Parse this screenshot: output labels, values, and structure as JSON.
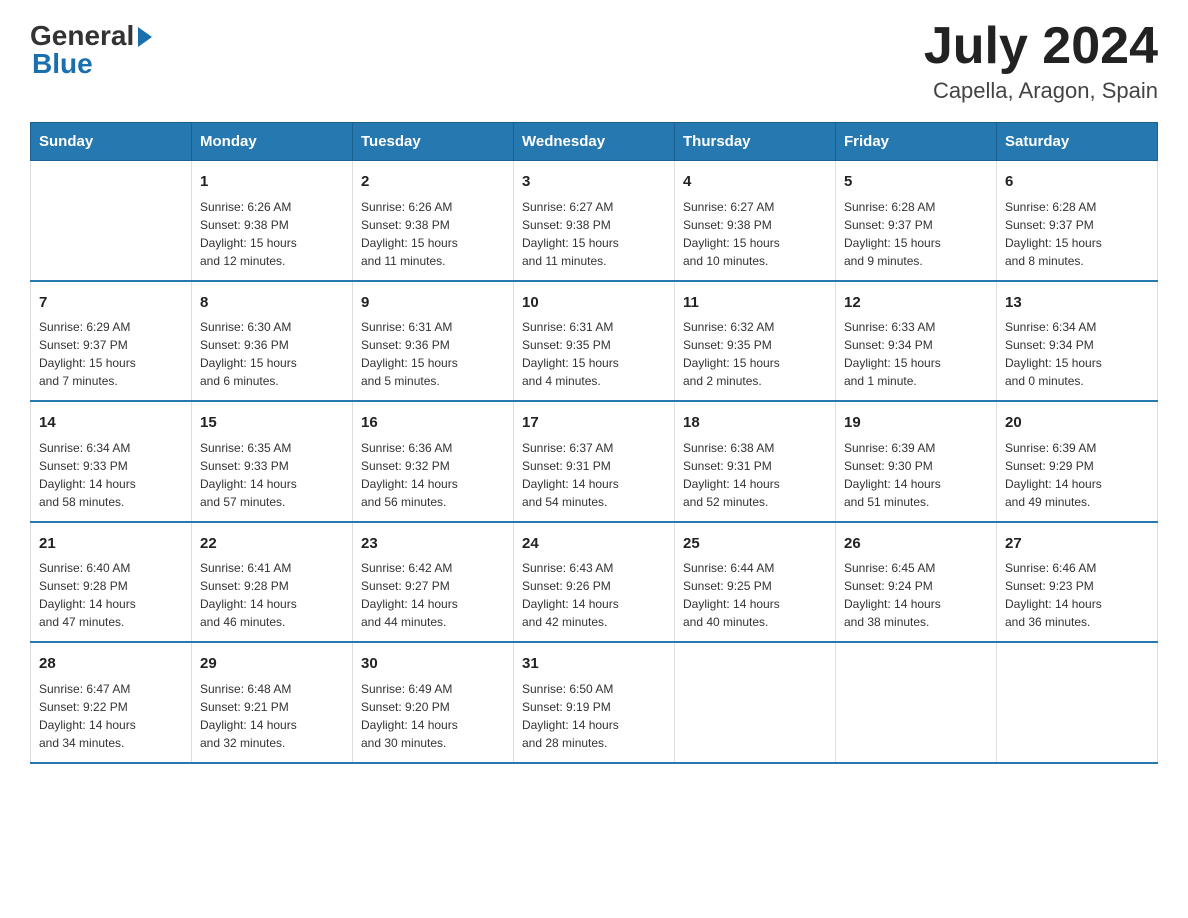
{
  "logo": {
    "general": "General",
    "blue": "Blue"
  },
  "title": "July 2024",
  "subtitle": "Capella, Aragon, Spain",
  "days_of_week": [
    "Sunday",
    "Monday",
    "Tuesday",
    "Wednesday",
    "Thursday",
    "Friday",
    "Saturday"
  ],
  "weeks": [
    [
      {
        "day": "",
        "info": ""
      },
      {
        "day": "1",
        "info": "Sunrise: 6:26 AM\nSunset: 9:38 PM\nDaylight: 15 hours\nand 12 minutes."
      },
      {
        "day": "2",
        "info": "Sunrise: 6:26 AM\nSunset: 9:38 PM\nDaylight: 15 hours\nand 11 minutes."
      },
      {
        "day": "3",
        "info": "Sunrise: 6:27 AM\nSunset: 9:38 PM\nDaylight: 15 hours\nand 11 minutes."
      },
      {
        "day": "4",
        "info": "Sunrise: 6:27 AM\nSunset: 9:38 PM\nDaylight: 15 hours\nand 10 minutes."
      },
      {
        "day": "5",
        "info": "Sunrise: 6:28 AM\nSunset: 9:37 PM\nDaylight: 15 hours\nand 9 minutes."
      },
      {
        "day": "6",
        "info": "Sunrise: 6:28 AM\nSunset: 9:37 PM\nDaylight: 15 hours\nand 8 minutes."
      }
    ],
    [
      {
        "day": "7",
        "info": "Sunrise: 6:29 AM\nSunset: 9:37 PM\nDaylight: 15 hours\nand 7 minutes."
      },
      {
        "day": "8",
        "info": "Sunrise: 6:30 AM\nSunset: 9:36 PM\nDaylight: 15 hours\nand 6 minutes."
      },
      {
        "day": "9",
        "info": "Sunrise: 6:31 AM\nSunset: 9:36 PM\nDaylight: 15 hours\nand 5 minutes."
      },
      {
        "day": "10",
        "info": "Sunrise: 6:31 AM\nSunset: 9:35 PM\nDaylight: 15 hours\nand 4 minutes."
      },
      {
        "day": "11",
        "info": "Sunrise: 6:32 AM\nSunset: 9:35 PM\nDaylight: 15 hours\nand 2 minutes."
      },
      {
        "day": "12",
        "info": "Sunrise: 6:33 AM\nSunset: 9:34 PM\nDaylight: 15 hours\nand 1 minute."
      },
      {
        "day": "13",
        "info": "Sunrise: 6:34 AM\nSunset: 9:34 PM\nDaylight: 15 hours\nand 0 minutes."
      }
    ],
    [
      {
        "day": "14",
        "info": "Sunrise: 6:34 AM\nSunset: 9:33 PM\nDaylight: 14 hours\nand 58 minutes."
      },
      {
        "day": "15",
        "info": "Sunrise: 6:35 AM\nSunset: 9:33 PM\nDaylight: 14 hours\nand 57 minutes."
      },
      {
        "day": "16",
        "info": "Sunrise: 6:36 AM\nSunset: 9:32 PM\nDaylight: 14 hours\nand 56 minutes."
      },
      {
        "day": "17",
        "info": "Sunrise: 6:37 AM\nSunset: 9:31 PM\nDaylight: 14 hours\nand 54 minutes."
      },
      {
        "day": "18",
        "info": "Sunrise: 6:38 AM\nSunset: 9:31 PM\nDaylight: 14 hours\nand 52 minutes."
      },
      {
        "day": "19",
        "info": "Sunrise: 6:39 AM\nSunset: 9:30 PM\nDaylight: 14 hours\nand 51 minutes."
      },
      {
        "day": "20",
        "info": "Sunrise: 6:39 AM\nSunset: 9:29 PM\nDaylight: 14 hours\nand 49 minutes."
      }
    ],
    [
      {
        "day": "21",
        "info": "Sunrise: 6:40 AM\nSunset: 9:28 PM\nDaylight: 14 hours\nand 47 minutes."
      },
      {
        "day": "22",
        "info": "Sunrise: 6:41 AM\nSunset: 9:28 PM\nDaylight: 14 hours\nand 46 minutes."
      },
      {
        "day": "23",
        "info": "Sunrise: 6:42 AM\nSunset: 9:27 PM\nDaylight: 14 hours\nand 44 minutes."
      },
      {
        "day": "24",
        "info": "Sunrise: 6:43 AM\nSunset: 9:26 PM\nDaylight: 14 hours\nand 42 minutes."
      },
      {
        "day": "25",
        "info": "Sunrise: 6:44 AM\nSunset: 9:25 PM\nDaylight: 14 hours\nand 40 minutes."
      },
      {
        "day": "26",
        "info": "Sunrise: 6:45 AM\nSunset: 9:24 PM\nDaylight: 14 hours\nand 38 minutes."
      },
      {
        "day": "27",
        "info": "Sunrise: 6:46 AM\nSunset: 9:23 PM\nDaylight: 14 hours\nand 36 minutes."
      }
    ],
    [
      {
        "day": "28",
        "info": "Sunrise: 6:47 AM\nSunset: 9:22 PM\nDaylight: 14 hours\nand 34 minutes."
      },
      {
        "day": "29",
        "info": "Sunrise: 6:48 AM\nSunset: 9:21 PM\nDaylight: 14 hours\nand 32 minutes."
      },
      {
        "day": "30",
        "info": "Sunrise: 6:49 AM\nSunset: 9:20 PM\nDaylight: 14 hours\nand 30 minutes."
      },
      {
        "day": "31",
        "info": "Sunrise: 6:50 AM\nSunset: 9:19 PM\nDaylight: 14 hours\nand 28 minutes."
      },
      {
        "day": "",
        "info": ""
      },
      {
        "day": "",
        "info": ""
      },
      {
        "day": "",
        "info": ""
      }
    ]
  ]
}
